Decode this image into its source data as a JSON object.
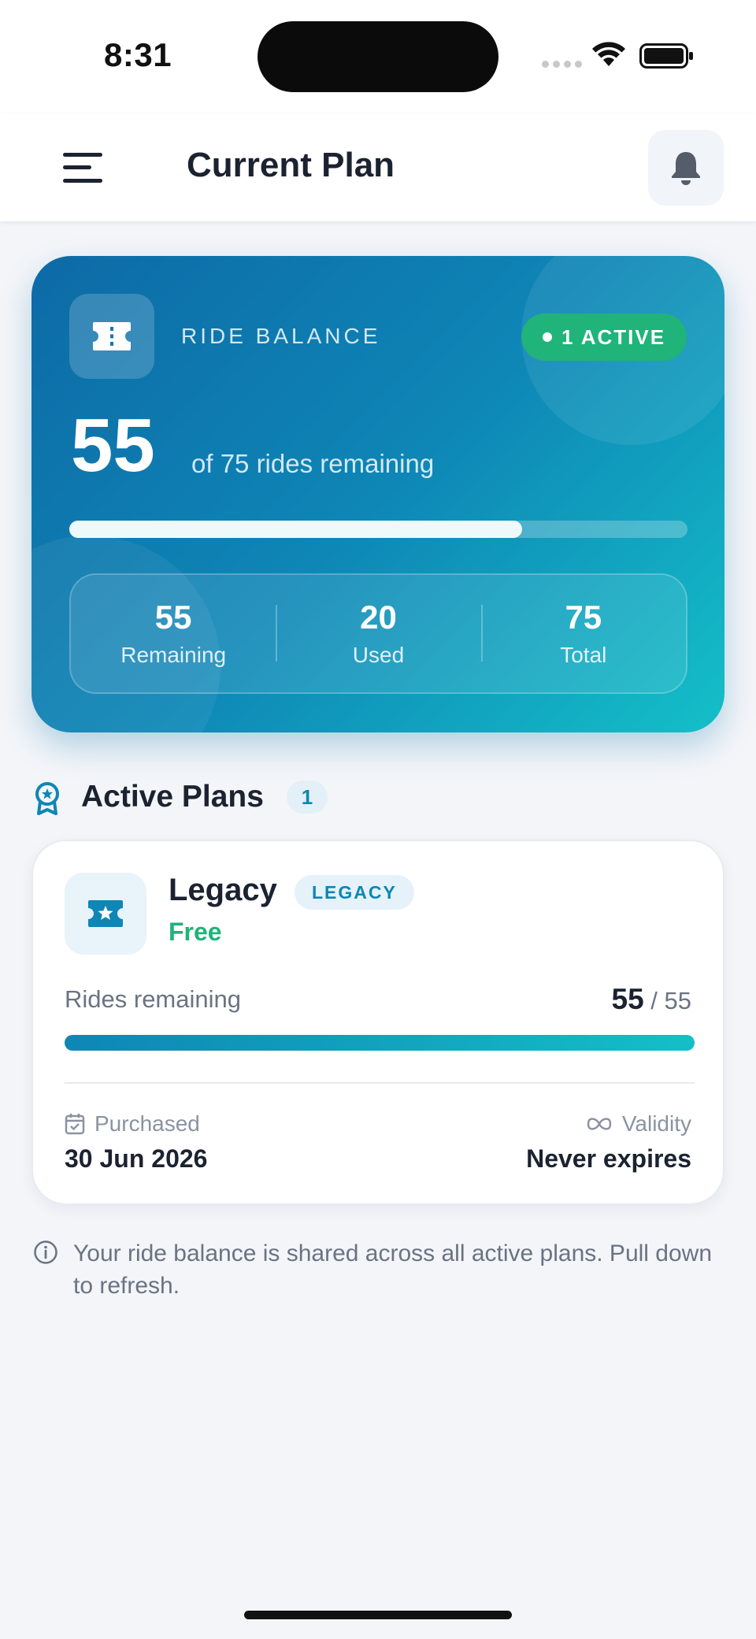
{
  "status_bar": {
    "time": "8:31"
  },
  "header": {
    "title": "Current Plan"
  },
  "balance": {
    "label": "RIDE BALANCE",
    "badge": "1 ACTIVE",
    "remaining": "55",
    "remaining_text": "of 75 rides remaining",
    "progress_fraction": 0.733,
    "stats": [
      {
        "value": "55",
        "label": "Remaining"
      },
      {
        "value": "20",
        "label": "Used"
      },
      {
        "value": "75",
        "label": "Total"
      }
    ]
  },
  "active_plans": {
    "title": "Active Plans",
    "count": "1",
    "plans": [
      {
        "name": "Legacy",
        "tag": "LEGACY",
        "price": "Free",
        "rides_label": "Rides remaining",
        "rides_remaining": "55",
        "rides_total": "/ 55",
        "progress_fraction": 1.0,
        "purchased_label": "Purchased",
        "purchased_value": "30 Jun 2026",
        "validity_label": "Validity",
        "validity_value": "Never expires"
      }
    ]
  },
  "info_text": "Your ride balance is shared across all active plans. Pull down to refresh.",
  "colors": {
    "accent": "#0e86b6",
    "success": "#20b37a",
    "card_gradient_start": "#0d6aa6",
    "card_gradient_end": "#14bfc8"
  },
  "icons": {
    "menu": "menu-icon",
    "bell": "bell-icon",
    "ticket": "ticket-icon",
    "award": "award-icon",
    "star_ticket": "star-ticket-icon",
    "calendar": "calendar-check-icon",
    "infinity": "infinity-icon",
    "info": "info-icon"
  }
}
